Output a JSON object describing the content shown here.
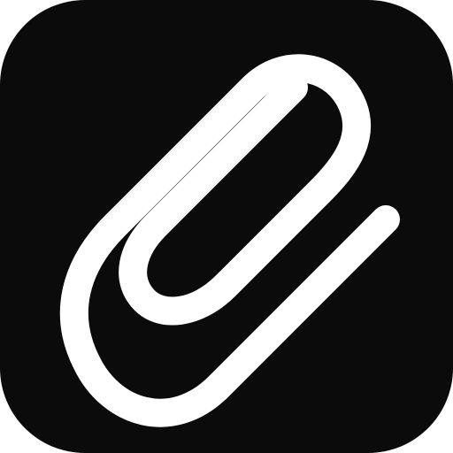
{
  "app_icon": {
    "icon": "paperclip-icon",
    "colors": {
      "background": "#0b0b0b",
      "glyph": "#ffffff"
    }
  }
}
